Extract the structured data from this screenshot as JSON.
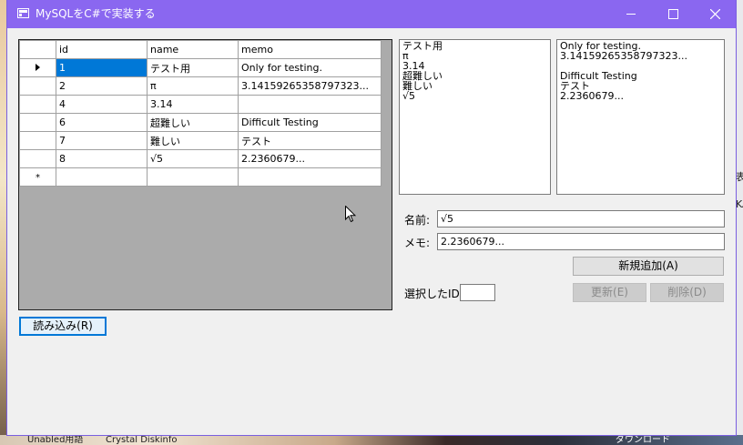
{
  "window": {
    "title": "MySQLをC#で実装する"
  },
  "grid": {
    "columns": [
      "id",
      "name",
      "memo"
    ],
    "rows": [
      {
        "id": "1",
        "name": "テスト用",
        "memo": "Only for testing."
      },
      {
        "id": "2",
        "name": "π",
        "memo": "3.14159265358797323..."
      },
      {
        "id": "4",
        "name": "3.14",
        "memo": ""
      },
      {
        "id": "6",
        "name": "超難しい",
        "memo": "Difficult Testing"
      },
      {
        "id": "7",
        "name": "難しい",
        "memo": "テスト"
      },
      {
        "id": "8",
        "name": "√5",
        "memo": "2.2360679..."
      }
    ],
    "new_row_marker": "*"
  },
  "name_list": [
    "テスト用",
    "π",
    "3.14",
    "超難しい",
    "難しい",
    "√5"
  ],
  "memo_list": [
    "Only for testing.",
    "3.14159265358797323...",
    "",
    "Difficult Testing",
    "テスト",
    "2.2360679..."
  ],
  "form": {
    "name_label": "名前:",
    "name_value": "√5",
    "memo_label": "メモ:",
    "memo_value": "2.2360679...",
    "selected_id_label": "選択したID:",
    "selected_id_value": ""
  },
  "buttons": {
    "add": "新規追加(A)",
    "update": "更新(E)",
    "delete": "削除(D)",
    "load": "読み込み(R)"
  },
  "desktop": {
    "bottom_text_1": "Unabled用語",
    "bottom_text_2": "Crystal Diskinfo",
    "bottom_text_3": "ダウンロード",
    "right_text_1": "表示",
    "right_text_2": "KA"
  },
  "colors": {
    "titlebar": "#8a67f0",
    "selection": "#0078d7"
  }
}
